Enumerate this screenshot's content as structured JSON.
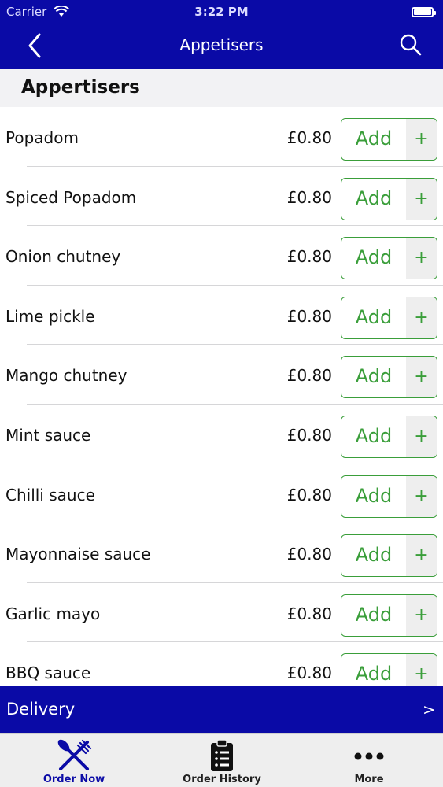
{
  "status_bar": {
    "carrier": "Carrier",
    "time": "3:22 PM"
  },
  "nav": {
    "title": "Appetisers",
    "back_icon": "chevron-left-icon",
    "search_icon": "search-icon"
  },
  "section": {
    "title": "Appertisers"
  },
  "add_button": {
    "label": "Add",
    "plus": "+"
  },
  "items": [
    {
      "name": "Popadom",
      "price": "£0.80"
    },
    {
      "name": "Spiced Popadom",
      "price": "£0.80"
    },
    {
      "name": "Onion chutney",
      "price": "£0.80"
    },
    {
      "name": "Lime pickle",
      "price": "£0.80"
    },
    {
      "name": "Mango chutney",
      "price": "£0.80"
    },
    {
      "name": "Mint sauce",
      "price": "£0.80"
    },
    {
      "name": "Chilli sauce",
      "price": "£0.80"
    },
    {
      "name": "Mayonnaise sauce",
      "price": "£0.80"
    },
    {
      "name": "Garlic mayo",
      "price": "£0.80"
    },
    {
      "name": "BBQ sauce",
      "price": "£0.80"
    }
  ],
  "delivery": {
    "label": "Delivery",
    "chevron": ">"
  },
  "tabs": [
    {
      "label": "Order Now",
      "icon": "fork-knife-icon",
      "active": true
    },
    {
      "label": "Order History",
      "icon": "clipboard-list-icon",
      "active": false
    },
    {
      "label": "More",
      "icon": "more-dots-icon",
      "active": false
    }
  ],
  "colors": {
    "brand": "#0a0aa6",
    "add_green": "#3a9e3a",
    "header_bg": "#f2f2f4",
    "tabbar_bg": "#eeeeee"
  }
}
